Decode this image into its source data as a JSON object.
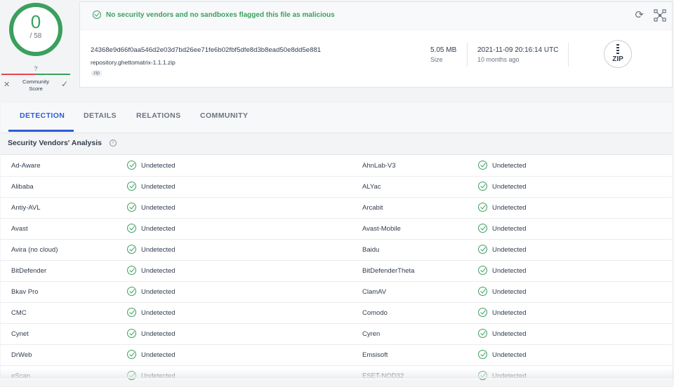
{
  "score": {
    "detections": "0",
    "total": "/ 58"
  },
  "community": {
    "value": "?",
    "label": "Community Score"
  },
  "banner": {
    "text": "No security vendors and no sandboxes flagged this file as malicious"
  },
  "file": {
    "hash": "24368e9d66f0aa546d2e03d7bd26ee71fe6b02fbf5dfe8d3b8ead50e8dd5e881",
    "name": "repository.ghettomatrix-1.1.1.zip",
    "tag": "zip",
    "size_value": "5.05 MB",
    "size_label": "Size",
    "date_value": "2021-11-09 20:16:14 UTC",
    "date_label": "10 months ago",
    "type_icon_text": "ZIP"
  },
  "tabs": [
    {
      "label": "DETECTION"
    },
    {
      "label": "DETAILS"
    },
    {
      "label": "RELATIONS"
    },
    {
      "label": "COMMUNITY"
    }
  ],
  "section": {
    "title": "Security Vendors' Analysis"
  },
  "vendors": [
    {
      "left": {
        "name": "Ad-Aware",
        "result": "Undetected"
      },
      "right": {
        "name": "AhnLab-V3",
        "result": "Undetected"
      }
    },
    {
      "left": {
        "name": "Alibaba",
        "result": "Undetected"
      },
      "right": {
        "name": "ALYac",
        "result": "Undetected"
      }
    },
    {
      "left": {
        "name": "Antiy-AVL",
        "result": "Undetected"
      },
      "right": {
        "name": "Arcabit",
        "result": "Undetected"
      }
    },
    {
      "left": {
        "name": "Avast",
        "result": "Undetected"
      },
      "right": {
        "name": "Avast-Mobile",
        "result": "Undetected"
      }
    },
    {
      "left": {
        "name": "Avira (no cloud)",
        "result": "Undetected"
      },
      "right": {
        "name": "Baidu",
        "result": "Undetected"
      }
    },
    {
      "left": {
        "name": "BitDefender",
        "result": "Undetected"
      },
      "right": {
        "name": "BitDefenderTheta",
        "result": "Undetected"
      }
    },
    {
      "left": {
        "name": "Bkav Pro",
        "result": "Undetected"
      },
      "right": {
        "name": "ClamAV",
        "result": "Undetected"
      }
    },
    {
      "left": {
        "name": "CMC",
        "result": "Undetected"
      },
      "right": {
        "name": "Comodo",
        "result": "Undetected"
      }
    },
    {
      "left": {
        "name": "Cynet",
        "result": "Undetected"
      },
      "right": {
        "name": "Cyren",
        "result": "Undetected"
      }
    },
    {
      "left": {
        "name": "DrWeb",
        "result": "Undetected"
      },
      "right": {
        "name": "Emsisoft",
        "result": "Undetected"
      }
    },
    {
      "left": {
        "name": "eScan",
        "result": "Undetected"
      },
      "right": {
        "name": "ESET-NOD32",
        "result": "Undetected"
      }
    }
  ],
  "colors": {
    "clean": "#3aa05e",
    "accent": "#2d5bd7",
    "malicious": "#e5484d"
  }
}
